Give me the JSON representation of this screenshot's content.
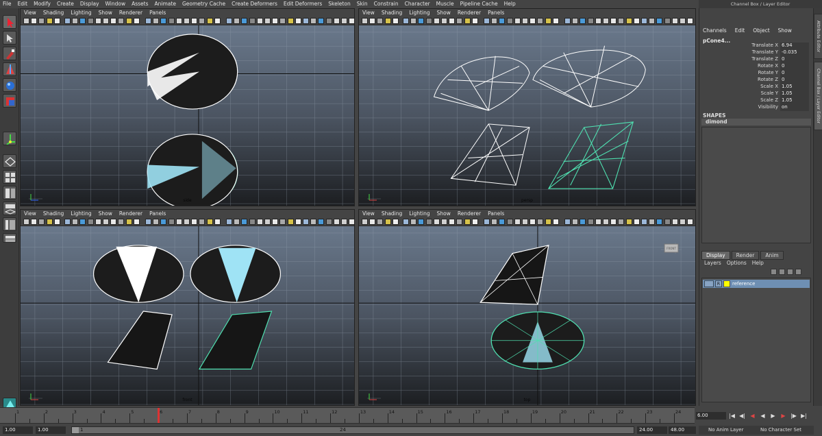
{
  "menubar": [
    "File",
    "Edit",
    "Modify",
    "Create",
    "Display",
    "Window",
    "Assets",
    "Animate",
    "Geometry Cache",
    "Create Deformers",
    "Edit Deformers",
    "Skeleton",
    "Skin",
    "Constrain",
    "Character",
    "Muscle",
    "Pipeline Cache",
    "Help"
  ],
  "viewport_menu": [
    "View",
    "Shading",
    "Lighting",
    "Show",
    "Renderer",
    "Panels"
  ],
  "viewports": {
    "top_left_label": "side",
    "top_right_label": "persp",
    "bottom_left_label": "front",
    "bottom_right_label": "top",
    "view_cube_label": "FRONT"
  },
  "channel_box": {
    "title": "Channel Box / Layer Editor",
    "menu": [
      "Channels",
      "Edit",
      "Object",
      "Show"
    ],
    "object_name": "pCone4...",
    "attributes": [
      {
        "label": "Translate X",
        "value": "6.94"
      },
      {
        "label": "Translate Y",
        "value": "-0.035"
      },
      {
        "label": "Translate Z",
        "value": "0"
      },
      {
        "label": "Rotate X",
        "value": "0"
      },
      {
        "label": "Rotate Y",
        "value": "0"
      },
      {
        "label": "Rotate Z",
        "value": "0"
      },
      {
        "label": "Scale X",
        "value": "1.05"
      },
      {
        "label": "Scale Y",
        "value": "1.05"
      },
      {
        "label": "Scale Z",
        "value": "1.05"
      },
      {
        "label": "Visibility",
        "value": "on"
      }
    ],
    "shapes_header": "SHAPES",
    "shape_name": "dimond"
  },
  "side_tabs": [
    "Attribute Editor",
    "Channel Box / Layer Editor"
  ],
  "layer_editor": {
    "tabs": [
      "Display",
      "Render",
      "Anim"
    ],
    "menu": [
      "Layers",
      "Options",
      "Help"
    ],
    "layer": {
      "r_label": "R",
      "name": "reference",
      "color": "#ffff00"
    }
  },
  "timeline": {
    "ticks": [
      "1",
      "2",
      "3",
      "4",
      "5",
      "6",
      "7",
      "8",
      "9",
      "10",
      "11",
      "12",
      "13",
      "14",
      "15",
      "16",
      "17",
      "18",
      "19",
      "20",
      "21",
      "22",
      "23",
      "24"
    ],
    "current_time": "6.00",
    "current_frame": 6
  },
  "range": {
    "start": "1.00",
    "playback_start": "1.00",
    "slider_start": "1",
    "slider_end": "24",
    "playback_end": "24.00",
    "end": "48.00",
    "anim_layer": "No Anim Layer",
    "character_set": "No Character Set"
  },
  "colors": {
    "wire_selected": "#4fe0b0",
    "wire": "#ffffff",
    "highlight": "#9fe3f5"
  }
}
